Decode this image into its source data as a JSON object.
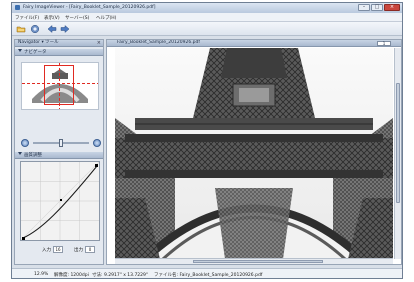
{
  "window": {
    "title": "Fairy ImageViewer - [Fairy_Booklet_Sample_20120926.pdf]",
    "controls": [
      "–",
      "□",
      "×"
    ]
  },
  "menu": [
    {
      "label": "ファイル(F)"
    },
    {
      "label": "表示(V)"
    },
    {
      "label": "サーバー(S)"
    },
    {
      "label": "ヘルプ(H)"
    }
  ],
  "toolbar": {
    "icons": [
      "open-folder-icon",
      "view-icon",
      "back-arrow-icon",
      "forward-arrow-icon"
    ]
  },
  "sidebar": {
    "top_bar_label": "Navigator ▾ ツール",
    "navigator_header": "ナビゲータ",
    "adjust_header": "画質調整",
    "input_label": "入力",
    "input_value": "16",
    "output_label": "出力",
    "output_value": "0",
    "zoom_level": 0.5
  },
  "viewer": {
    "tab_label": "Fairy_Booklet_Sample_20120926.pdf",
    "page_value": "1"
  },
  "status": {
    "zoom": "12.9%",
    "resolution": "解像度: 1200dpi",
    "size": "寸法: 9.2917\" x 13.7229\"",
    "file": "ファイル名: Fairy_Booklet_Sample_20120926.pdf"
  },
  "colors": {
    "accent": "#3c6fb0",
    "navigator_frame": "#e02a22"
  }
}
